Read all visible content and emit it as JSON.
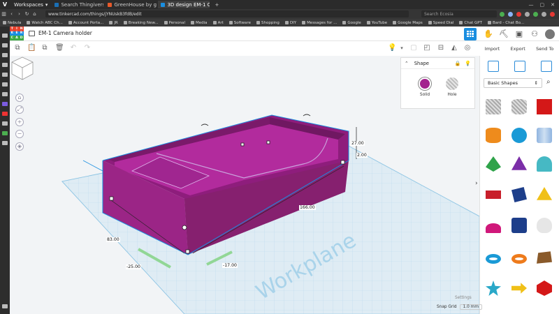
{
  "browser": {
    "workspaces_label": "Workspaces",
    "tabs": [
      {
        "label": "Search Thingiverse - Thin...",
        "color": "#1a6fb5"
      },
      {
        "label": "GreenHouse by gillis | Do...",
        "color": "#e85a2a"
      },
      {
        "label": "3D design EM-1 Camera hol",
        "color": "#1a8ee0",
        "active": true
      }
    ],
    "url": "www.tinkercad.com/things/jYNUskB3fdB/edit",
    "search_placeholder": "Search Ecosia",
    "bookmarks": [
      "Nebula",
      "Watch ABC Ch...",
      "Account Porta...",
      "JR",
      "Breaking New...",
      "Personal",
      "Media",
      "Art",
      "Software",
      "Shopping",
      "DIY",
      "Messages for ...",
      "Google",
      "YouTube",
      "Google Maps",
      "Speed Dial",
      "Chat GPT",
      "Bard - Chat Bo..."
    ]
  },
  "app": {
    "logo_letters": [
      "TIN",
      "KER",
      "CAD"
    ],
    "design_title": "EM-1 Camera holder",
    "actions": {
      "import": "Import",
      "export": "Export",
      "send_to": "Send To"
    }
  },
  "shape_panel": {
    "title": "Shape",
    "solid_label": "Solid",
    "hole_label": "Hole",
    "solid_color": "#a3238e"
  },
  "library": {
    "category": "Basic Shapes"
  },
  "viewport": {
    "dims": {
      "height": "27.00",
      "elevation": "2.00",
      "length": "166.00",
      "width": "83.00",
      "x_offset": "-25.00",
      "y_offset": "-17.00"
    },
    "workplane_label": "Workplane",
    "settings_label": "Settings",
    "snap_grid_label": "Snap Grid",
    "snap_grid_value": "1.0 mm"
  },
  "colors": {
    "accent": "#1a8ee0",
    "object_magenta": "#9b2586",
    "workplane": "#cfe6f3"
  }
}
